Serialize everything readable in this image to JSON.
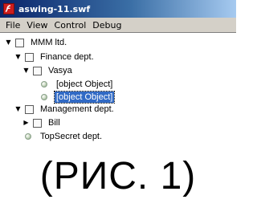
{
  "window": {
    "title": "aswing-11.swf",
    "icon": "flash-player-icon"
  },
  "menu": [
    "File",
    "View",
    "Control",
    "Debug"
  ],
  "tree": [
    {
      "label": "MMM ltd.",
      "expanded": true,
      "node": "folder"
    },
    {
      "label": "Finance dept.",
      "expanded": true,
      "node": "folder"
    },
    {
      "label": "Vasya",
      "expanded": true,
      "node": "folder"
    },
    {
      "label": "[object Object]",
      "node": "leaf"
    },
    {
      "label": "[object Object]",
      "node": "leaf",
      "selected": true
    },
    {
      "label": "Management dept.",
      "expanded": true,
      "node": "folder"
    },
    {
      "label": "Bill",
      "expanded": false,
      "node": "folder"
    },
    {
      "label": "TopSecret dept.",
      "node": "leaf"
    }
  ],
  "caption": "(РИС. 1)",
  "colors": {
    "selection": "#316ac5",
    "titlebar": "#0a246a",
    "menubar": "#d4d0c8"
  }
}
